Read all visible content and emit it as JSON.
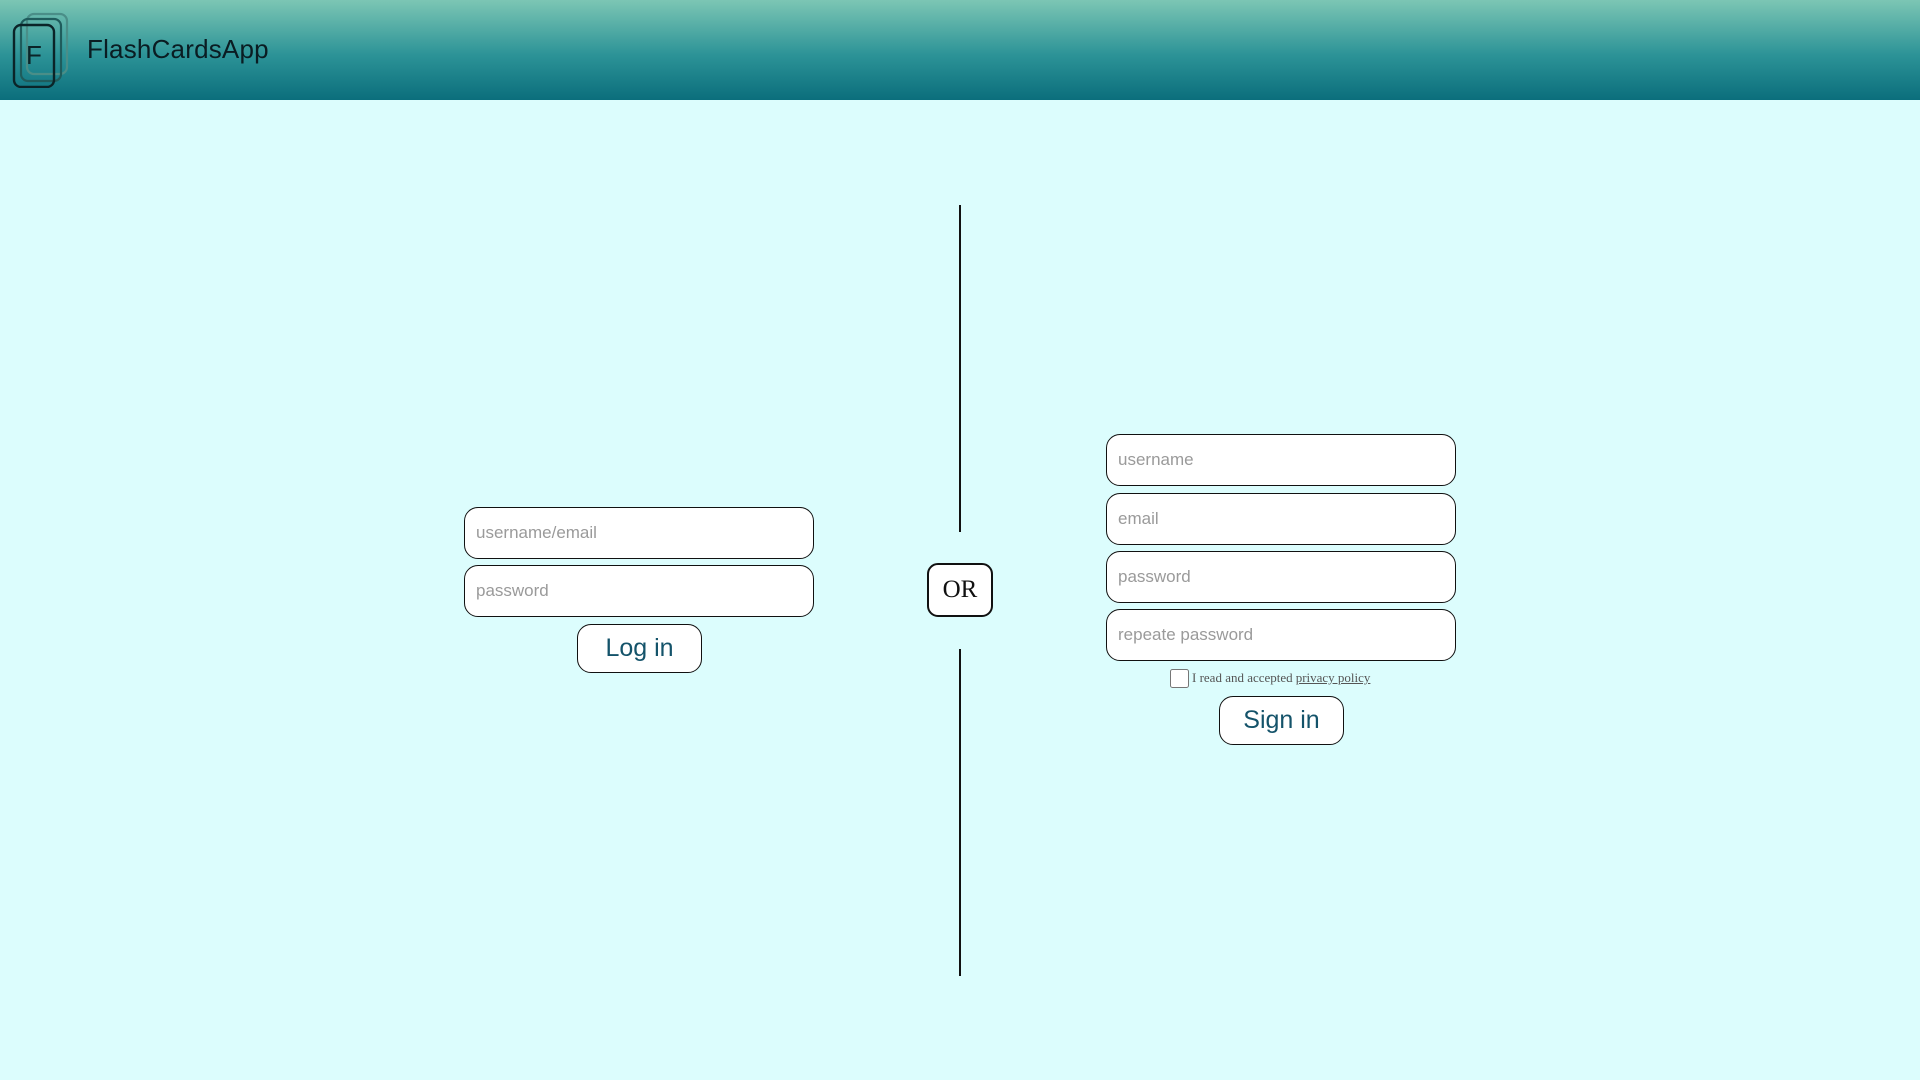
{
  "header": {
    "logo_letter": "F",
    "app_title": "FlashCardsApp"
  },
  "login": {
    "username_placeholder": "username/email",
    "password_placeholder": "password",
    "login_label": "Log in"
  },
  "divider": {
    "or_label": "OR"
  },
  "signup": {
    "username_placeholder": "username",
    "email_placeholder": "email",
    "password_placeholder": "password",
    "repeat_password_placeholder": "repeate password",
    "policy_text": "I read and accepted",
    "policy_link": "privacy policy",
    "policy_checked": false,
    "signin_label": "Sign in"
  }
}
